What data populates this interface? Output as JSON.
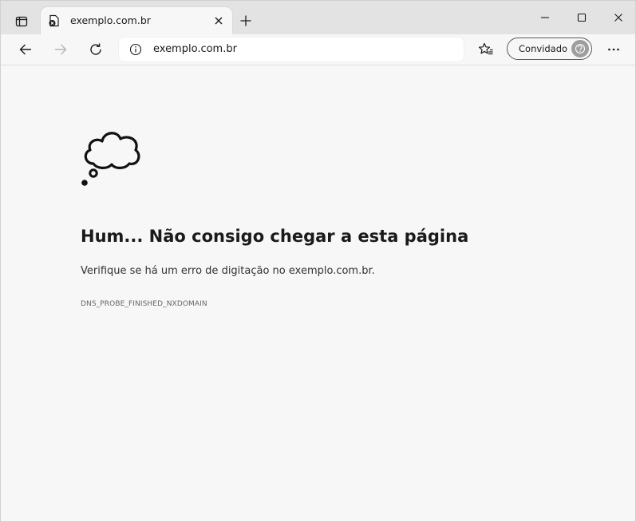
{
  "colors": {
    "tabstrip_bg": "#e3e3e3",
    "page_bg": "#f7f7f7",
    "text_primary": "#1a1a1a",
    "text_secondary": "#666666"
  },
  "tab_bar": {
    "tab_actions_icon": "tab-actions-icon",
    "tabs": [
      {
        "title": "exemplo.com.br",
        "favicon": "error-page-icon",
        "active": true
      }
    ],
    "tab_close_icon": "close-icon",
    "new_tab_icon": "plus-icon"
  },
  "window_controls": [
    "minimize-icon",
    "maximize-icon",
    "close-icon"
  ],
  "toolbar": {
    "back_icon": "back-arrow-icon",
    "forward_icon": "forward-arrow-icon",
    "forward_enabled": false,
    "refresh_icon": "refresh-icon",
    "address": {
      "info_icon": "info-icon",
      "url": "exemplo.com.br"
    },
    "favorites_icon": "favorites-star-icon",
    "profile": {
      "label": "Convidado",
      "avatar_icon": "guest-avatar-icon"
    },
    "more_icon": "more-dots-icon"
  },
  "error_page": {
    "icon": "thought-cloud-icon",
    "heading": "Hum... Não consigo chegar a esta página",
    "message": "Verifique se há um erro de digitação no exemplo.com.br.",
    "code": "DNS_PROBE_FINISHED_NXDOMAIN"
  }
}
